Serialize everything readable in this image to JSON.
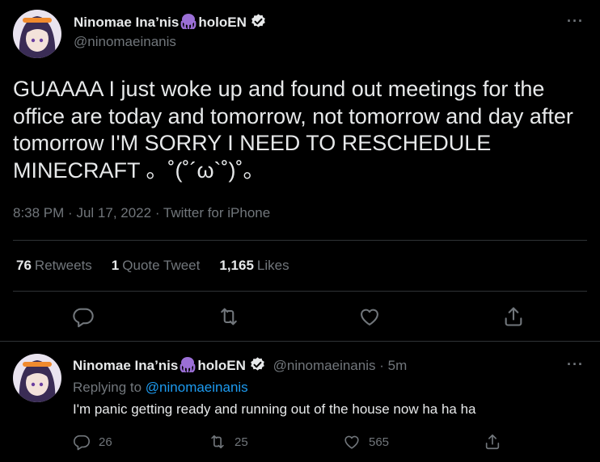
{
  "tweet": {
    "author_name": "Ninomae Ina’nis",
    "author_name_suffix": "holoEN",
    "author_handle": "@ninomaeinanis",
    "text": "GUAAAA I just woke up and found out meetings for the office are today and tomorrow, not tomorrow and day after tomorrow I'M SORRY I NEED TO RESCHEDULE MINECRAFT 。˚(˚´ω`˚)˚。",
    "time": "8:38 PM",
    "date": "Jul 17, 2022",
    "source": "Twitter for iPhone",
    "separator": "·",
    "more_label": "···",
    "stats": {
      "retweets": "76",
      "retweets_label": "Retweets",
      "quote_tweets": "1",
      "quote_tweets_label": "Quote Tweet",
      "likes": "1,165",
      "likes_label": "Likes"
    }
  },
  "reply": {
    "author_name": "Ninomae Ina’nis",
    "author_name_suffix": "holoEN",
    "author_handle": "@ninomaeinanis",
    "age": "5m",
    "replying_prefix": "Replying to",
    "replying_to": "@ninomaeinanis",
    "text": "I'm panic getting ready and running out of the house now ha ha ha",
    "more_label": "···",
    "counts": {
      "replies": "26",
      "retweets": "25",
      "likes": "565"
    }
  },
  "colors": {
    "background": "#000000",
    "text": "#e7e9ea",
    "muted": "#71767b",
    "link": "#1d9bf0",
    "octopus": "#9b6fd6",
    "divider": "#2f3336"
  },
  "icons": [
    "octopus-icon",
    "verified-badge-icon",
    "more-icon",
    "reply-icon",
    "retweet-icon",
    "like-icon",
    "share-icon"
  ]
}
